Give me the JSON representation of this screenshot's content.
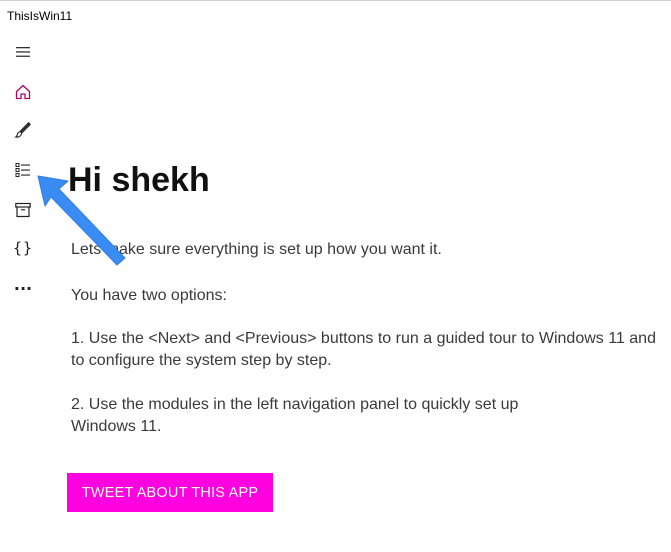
{
  "window": {
    "title": "ThisIsWin11"
  },
  "nav": {
    "items": [
      {
        "icon": "hamburger-menu-icon"
      },
      {
        "icon": "home-icon",
        "active": true,
        "accent": "#b0006a"
      },
      {
        "icon": "brush-icon"
      },
      {
        "icon": "list-icon"
      },
      {
        "icon": "archive-box-icon"
      },
      {
        "icon": "braces-icon",
        "glyph": "{}"
      },
      {
        "icon": "more-icon",
        "glyph": "..."
      }
    ]
  },
  "main": {
    "greeting": "Hi shekh",
    "intro": "Lets make sure everything is set up how you want it.",
    "options_heading": "You have two options:",
    "option_1": "1. Use the <Next> and <Previous> buttons to run a guided tour to Windows 11 and to configure the system step by step.",
    "option_2": "2. Use the modules in the left navigation panel to quickly set up Windows 11.",
    "tweet_button_label": "TWEET ABOUT THIS APP"
  },
  "colors": {
    "accent": "#ff00e0",
    "home_icon": "#b0006a",
    "annotation_arrow": "#3b8cf2"
  }
}
